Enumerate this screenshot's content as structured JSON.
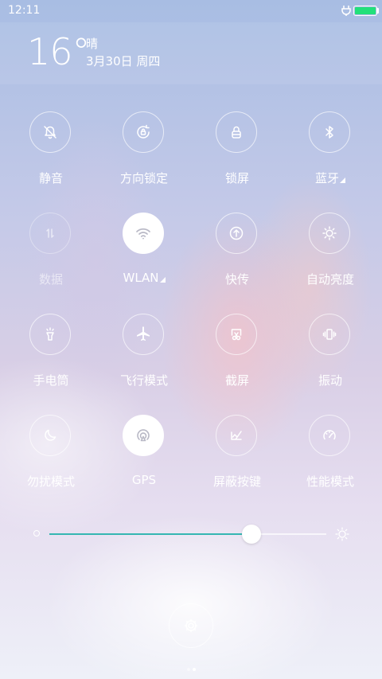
{
  "status_bar": {
    "time": "12:11",
    "battery_color": "#22e07a"
  },
  "weather": {
    "temperature": "16°",
    "condition": "晴",
    "date": "3月30日 周四"
  },
  "toggles": [
    {
      "label": "静音",
      "icon": "bell-off-icon",
      "state": "off"
    },
    {
      "label": "方向锁定",
      "icon": "rotation-lock-icon",
      "state": "off"
    },
    {
      "label": "锁屏",
      "icon": "lock-icon",
      "state": "off"
    },
    {
      "label": "蓝牙",
      "icon": "bluetooth-icon",
      "state": "off"
    },
    {
      "label": "数据",
      "icon": "mobile-data-icon",
      "state": "disabled"
    },
    {
      "label": "WLAN",
      "icon": "wifi-icon",
      "state": "on"
    },
    {
      "label": "快传",
      "icon": "quick-transfer-icon",
      "state": "off"
    },
    {
      "label": "自动亮度",
      "icon": "auto-brightness-icon",
      "state": "off"
    },
    {
      "label": "手电筒",
      "icon": "flashlight-icon",
      "state": "off"
    },
    {
      "label": "飞行模式",
      "icon": "airplane-icon",
      "state": "off"
    },
    {
      "label": "截屏",
      "icon": "screenshot-icon",
      "state": "off"
    },
    {
      "label": "振动",
      "icon": "vibrate-icon",
      "state": "off"
    },
    {
      "label": "勿扰模式",
      "icon": "moon-icon",
      "state": "off"
    },
    {
      "label": "GPS",
      "icon": "gps-icon",
      "state": "on"
    },
    {
      "label": "屏蔽按键",
      "icon": "block-keys-icon",
      "state": "off"
    },
    {
      "label": "性能模式",
      "icon": "performance-gauge-icon",
      "state": "off"
    }
  ],
  "brightness": {
    "level": 0.73,
    "accent": "#35b6b2"
  },
  "pager": {
    "pages": 2,
    "current": 2
  }
}
